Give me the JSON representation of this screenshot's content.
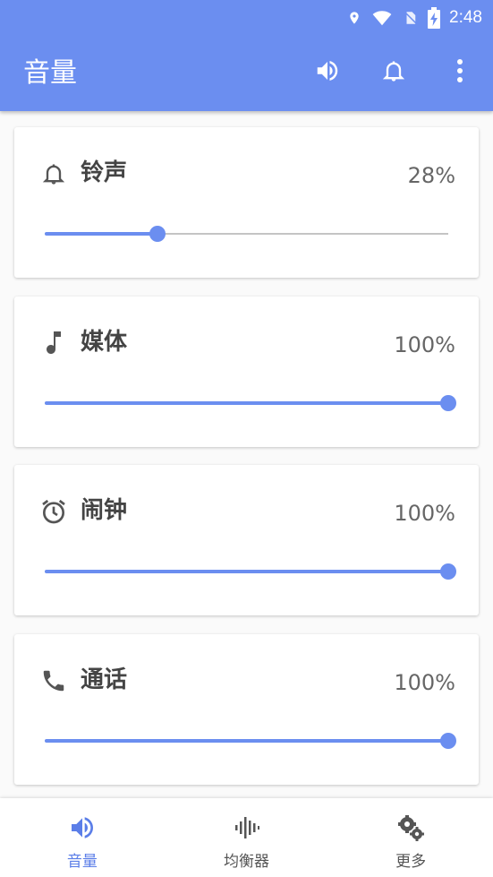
{
  "status_bar": {
    "time": "2:48",
    "icons": [
      "location-icon",
      "wifi-icon",
      "no-sim-icon",
      "battery-charging-icon"
    ]
  },
  "app_bar": {
    "title": "音量",
    "actions": [
      "volume-up-icon",
      "bell-icon",
      "more-vert-icon"
    ]
  },
  "colors": {
    "accent": "#6b8ef0",
    "track": "#c4c4c4",
    "title_text": "#444444",
    "value_text": "#666666"
  },
  "cards": [
    {
      "icon": "bell-icon",
      "title": "铃声",
      "value_text": "28%",
      "level": 0.28
    },
    {
      "icon": "music-note-icon",
      "title": "媒体",
      "value_text": "100%",
      "level": 1.0
    },
    {
      "icon": "alarm-icon",
      "title": "闹钟",
      "value_text": "100%",
      "level": 1.0
    },
    {
      "icon": "phone-icon",
      "title": "通话",
      "value_text": "100%",
      "level": 1.0
    }
  ],
  "bottom_nav": {
    "items": [
      {
        "label": "音量",
        "icon": "volume-up-icon",
        "active": true
      },
      {
        "label": "均衡器",
        "icon": "equalizer-icon",
        "active": false
      },
      {
        "label": "更多",
        "icon": "settings-gears-icon",
        "active": false
      }
    ]
  }
}
